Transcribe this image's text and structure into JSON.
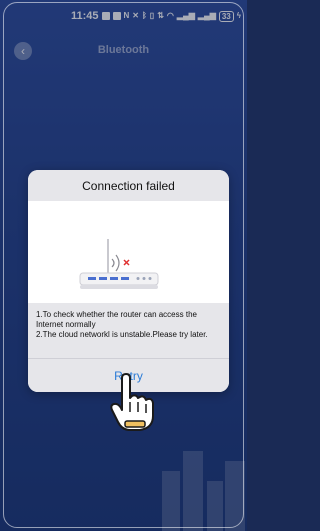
{
  "status_bar": {
    "time": "11:45",
    "battery": "33"
  },
  "header": {
    "back_icon": "back-arrow-icon",
    "title": "Bluetooth"
  },
  "dialog": {
    "title": "Connection failed",
    "illustration": "router-no-signal",
    "messages": [
      "1.To check whether the router can access the Internet normally",
      "2.The cloud networkl is unstable.Please try later."
    ],
    "retry_label": "Retry"
  },
  "gesture": {
    "icon": "tap-hand-icon"
  },
  "colors": {
    "background": "#27448c",
    "accent": "#2b7bd6",
    "router_led": "#4a6fd0",
    "error_x": "#e03030"
  }
}
